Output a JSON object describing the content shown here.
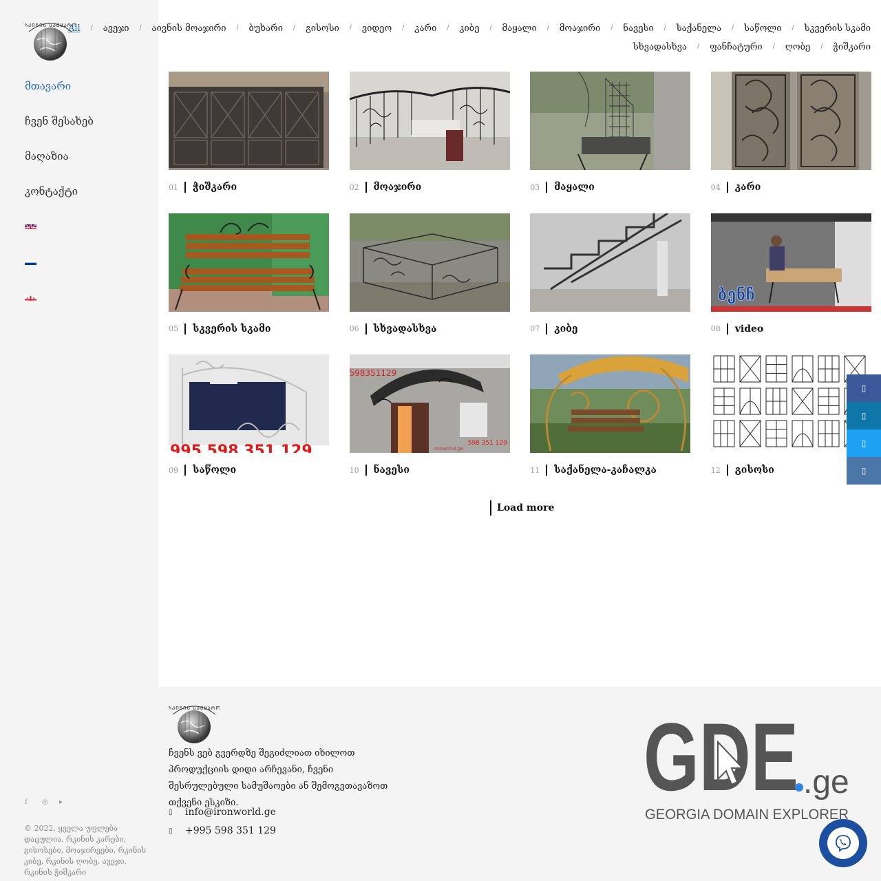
{
  "sidebar": {
    "nav": [
      {
        "label": "მთავარი",
        "active": true
      },
      {
        "label": "ჩვენ შესახებ",
        "active": false
      },
      {
        "label": "მაღაზია",
        "active": false
      },
      {
        "label": "კონტაქტი",
        "active": false
      }
    ],
    "flags": [
      "en-flag",
      "ru-flag",
      "ge-flag"
    ],
    "copyright": "© 2022, ყველა უფლება დაცულია. რკინის კარები, გისოსები, მოაჯირეები, რკინის კიბე, რკინის ღობე, ავეჯი, რკინის ჭიშკარი"
  },
  "filters": {
    "line1": [
      "All",
      "ავეჯი",
      "აივნის მოაჯირი",
      "ბუხარი",
      "გისოსი",
      "ვიდეო",
      "კარი",
      "კიბე",
      "მაყალი",
      "მოაჯირი",
      "ნავესი",
      "საქანელა",
      "საწოლი",
      "სკვერის სკამი"
    ],
    "line2": [
      "სხვადასხვა",
      "ფანჩატური",
      "ღობე",
      "ჭიშკარი"
    ],
    "active": "All"
  },
  "products": [
    {
      "num": "01",
      "title": "ჭიშკარი"
    },
    {
      "num": "02",
      "title": "მოაჯირი"
    },
    {
      "num": "03",
      "title": "მაყალი"
    },
    {
      "num": "04",
      "title": "კარი"
    },
    {
      "num": "05",
      "title": "სკვერის სკამი"
    },
    {
      "num": "06",
      "title": "სხვადასხვა"
    },
    {
      "num": "07",
      "title": "კიბე"
    },
    {
      "num": "08",
      "title": "video"
    },
    {
      "num": "09",
      "title": "საწოლი"
    },
    {
      "num": "10",
      "title": "ნავესი"
    },
    {
      "num": "11",
      "title": "საქანელა-კაჩალკა"
    },
    {
      "num": "12",
      "title": "გისოსი"
    }
  ],
  "image_text": {
    "bench_video_overlay": "ბენჩ",
    "canopy_phone": "598351129",
    "canopy_phone2": "598 351 129",
    "canopy_site": "ironworld.ge",
    "bed_phone": "995 598 351 129"
  },
  "load_more": "Load more",
  "social": [
    {
      "icon": "facebook-icon",
      "color": "#3b5998"
    },
    {
      "icon": "linkedin-icon",
      "color": "#0e76a8"
    },
    {
      "icon": "twitter-icon",
      "color": "#1da1f2"
    },
    {
      "icon": "vk-icon",
      "color": "#4a76a8"
    }
  ],
  "footer": {
    "description": "ჩვენს ვებ გვერდზე შეგიძლიათ იხილოთ პროდუქციის დიდი არჩევანი, ჩვენი შესრულებული სამუშაოები ან შემოგვთავაზოთ თქვენი ესკიზი.",
    "email": "info@ironworld.ge",
    "phone": "+995 598 351 129",
    "gde_logo_text": "GDE",
    "gde_domain": ".ge",
    "gde_tagline": "GEORGIA DOMAIN EXPLORER"
  }
}
